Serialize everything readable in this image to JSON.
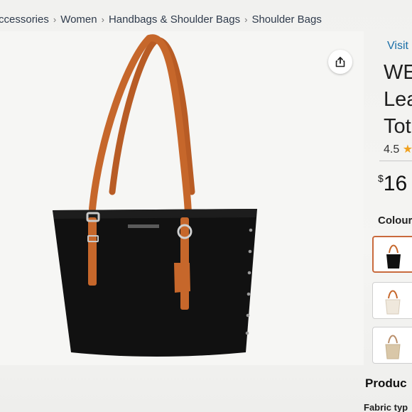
{
  "breadcrumb": {
    "items": [
      "Accessories",
      "Women",
      "Handbags & Shoulder Bags",
      "Shoulder Bags"
    ],
    "separator": "›"
  },
  "share": {
    "icon": "share-icon"
  },
  "product_image": {
    "alt": ""
  },
  "details": {
    "visit_link": "Visit",
    "title_lines": [
      "WE",
      "Lea",
      "Tot"
    ],
    "rating_value": "4.5",
    "price_currency": "$",
    "price_value": "16",
    "colour_label": "Colour",
    "swatches": [
      "black-tote",
      "cream-tote",
      "beige-tote"
    ],
    "product_heading": "Produc",
    "fabric_label": "Fabric typ"
  },
  "colors": {
    "accent_border": "#c96a3d",
    "link": "#1a6fa8",
    "star": "#f0a11e",
    "bag_body": "#111111",
    "strap": "#c6672b"
  }
}
